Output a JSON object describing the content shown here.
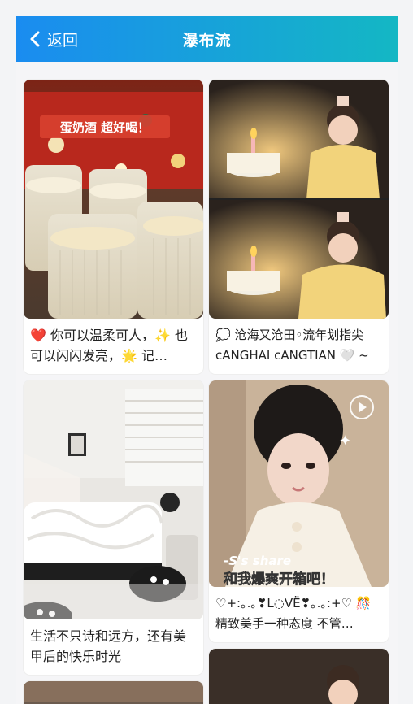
{
  "header": {
    "back_label": "返回",
    "title": "瀑布流"
  },
  "cards": [
    {
      "caption": "❤️ 你可以温柔可人，✨ 也可以闪闪发亮，🌟 记…",
      "overlay_text": "蛋奶酒  超好喝！"
    },
    {
      "caption": "💭 沧海又沧田◦流年划指尖 cANGHAI cANGTIAN 🤍 ~"
    },
    {
      "caption": "生活不只诗和远方，还有美甲后的快乐时光"
    },
    {
      "caption": "♡+:｡.｡❣L◌VË❣｡.｡:+♡ 🎊 精致美手一种态度 不管…",
      "overlay_text_1": "-S's share",
      "overlay_text_2": "和我爆爽开箱吧！"
    }
  ],
  "colors": {
    "header_start": "#1a8cf0",
    "header_end": "#14b7c4"
  }
}
